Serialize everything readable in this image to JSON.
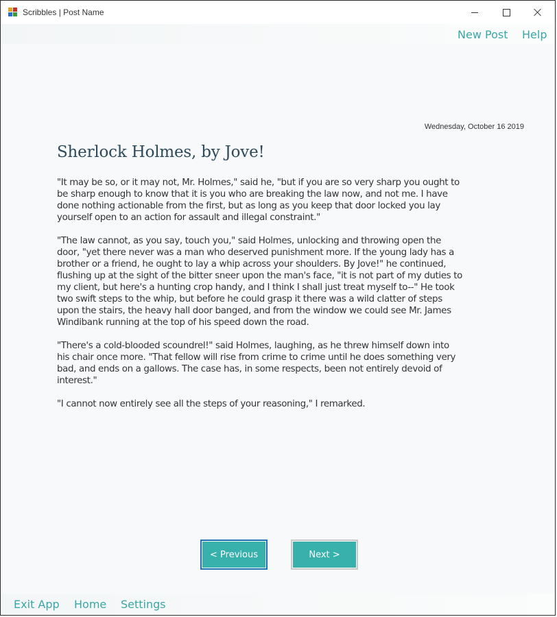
{
  "window": {
    "title": "Scribbles | Post Name"
  },
  "top_menu": {
    "new_post": "New Post",
    "help": "Help"
  },
  "post": {
    "date": "Wednesday, October 16 2019",
    "title": "Sherlock Holmes, by Jove!",
    "paragraphs": [
      "\"It may be so, or it may not, Mr. Holmes,\" said he, \"but if you are so very sharp you ought to be sharp enough to know that it is you who are breaking the law now, and not me. I have done nothing actionable from the first, but as long as you keep that door locked you lay yourself open to an action for assault and illegal constraint.\"",
      "\"The law cannot, as you say, touch you,\" said Holmes, unlocking and throwing open the door, \"yet there never was a man who deserved punishment more. If the young lady has a brother or a friend, he ought to lay a whip across your shoulders. By Jove!\" he continued, flushing up at the sight of the bitter sneer upon the man's face, \"it is not part of my duties to my client, but here's a hunting crop handy, and I think I shall just treat myself to--\" He took two swift steps to the whip, but before he could grasp it there was a wild clatter of steps upon the stairs, the heavy hall door banged, and from the window we could see Mr. James Windibank running at the top of his speed down the road.",
      "\"There's a cold-blooded scoundrel!\" said Holmes, laughing, as he threw himself down into his chair once more. \"That fellow will rise from crime to crime until he does something very bad, and ends on a gallows. The case has, in some respects, been not entirely devoid of interest.\"",
      "\"I cannot now entirely see all the steps of your reasoning,\" I remarked."
    ]
  },
  "nav": {
    "previous": "< Previous",
    "next": "Next >"
  },
  "bottom_menu": {
    "exit_app": "Exit App",
    "home": "Home",
    "settings": "Settings"
  },
  "colors": {
    "accent": "#38b1ad",
    "link": "#3aa7a4",
    "title": "#2c4a5a",
    "background": "#f7f9fa",
    "focus_border": "#1a6fb5"
  },
  "icons": {
    "app": "app-icon",
    "minimize": "minimize-icon",
    "maximize": "maximize-icon",
    "close": "close-icon"
  }
}
